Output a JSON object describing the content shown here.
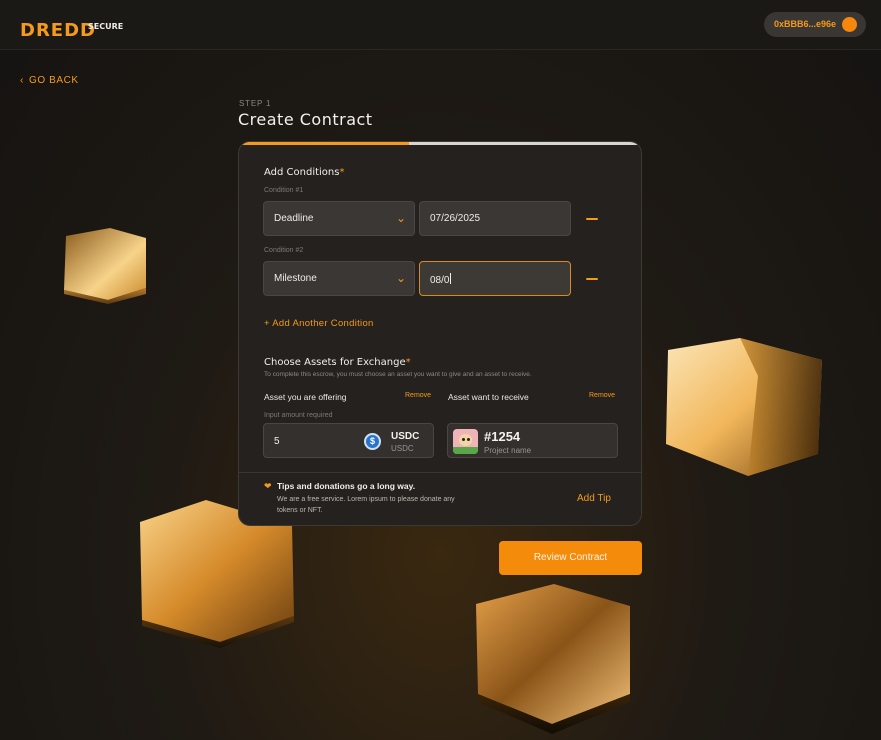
{
  "header": {
    "logo": "DREDD",
    "logo_suffix": "SECURE",
    "wallet_address": "0xBBB6...e96e"
  },
  "nav": {
    "back_label": "GO BACK",
    "back_icon": "chevron-left-icon"
  },
  "page": {
    "step_label": "STEP 1",
    "title": "Create Contract",
    "progress_fraction": 0.42
  },
  "conditions": {
    "title": "Add Conditions",
    "required_marker": "*",
    "items": [
      {
        "label": "Condition #1",
        "type": "Deadline",
        "value": "07/26/2025"
      },
      {
        "label": "Condition #2",
        "type": "Milestone",
        "value": "08/0"
      }
    ],
    "add_label": "+ Add Another Condition"
  },
  "assets": {
    "title": "Choose Assets for Exchange",
    "required_marker": "*",
    "description": "To complete this escrow, you must choose an asset you want to give and an asset to receive.",
    "offering": {
      "label": "Asset you are offering",
      "remove_label": "Remove",
      "input_label": "Input amount required",
      "amount": "5",
      "token_symbol": "USDC",
      "token_name": "USDC",
      "token_icon_glyph": "$"
    },
    "receiving": {
      "label": "Asset want to receive",
      "remove_label": "Remove",
      "nft_id": "#1254",
      "nft_project": "Project name"
    }
  },
  "tips": {
    "icon": "heart-hands-icon",
    "title": "Tips and donations go a long way.",
    "body": "We are a free service. Lorem ipsum to please donate any tokens or NFT.",
    "add_tip_label": "Add Tip"
  },
  "actions": {
    "review_label": "Review Contract"
  },
  "colors": {
    "accent": "#f59a1b",
    "button": "#f58b0b",
    "card": "#24211e",
    "background": "#1b1916"
  }
}
